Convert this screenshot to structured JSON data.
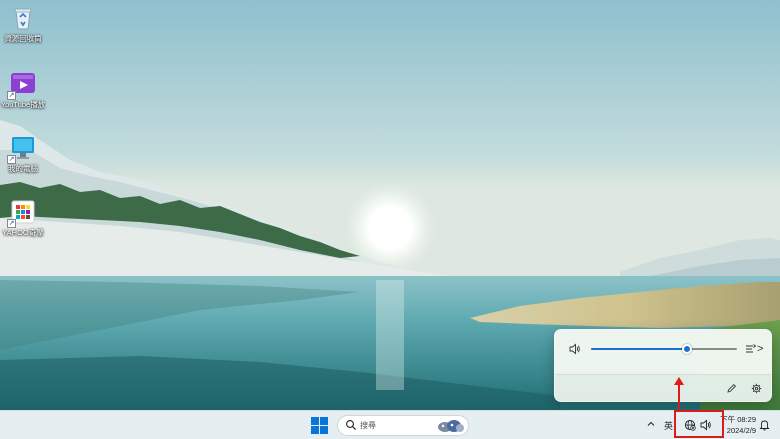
{
  "desktop": {
    "icons": [
      {
        "label": "資源回收筒",
        "icon": "recycle-bin-icon"
      },
      {
        "label": "YouTube播放",
        "icon": "youtube-app-icon"
      },
      {
        "label": "我的電腦",
        "icon": "monitor-icon"
      },
      {
        "label": "YAHOO奇摩",
        "icon": "yahoo-app-icon"
      }
    ]
  },
  "volume_flyout": {
    "level": 0.66,
    "speaker_icon": "speaker-icon",
    "output_icon": "audio-output-icon",
    "chevron": ">",
    "edit_icon": "pencil-icon",
    "settings_icon": "gear-icon"
  },
  "taskbar": {
    "start_icon": "windows-start-icon",
    "search": {
      "placeholder": "搜尋",
      "icon": "search-icon"
    },
    "tray": {
      "chevron_icon": "chevron-up-icon",
      "ime": "英",
      "network_icon": "globe-icon",
      "volume_icon": "speaker-icon",
      "time": "下午 08:29",
      "date": "2024/2/9",
      "notification_icon": "bell-icon"
    }
  },
  "colors": {
    "accent": "#1a6fd1",
    "annotation": "#e0191b",
    "windows_blue": "#0a74da"
  }
}
